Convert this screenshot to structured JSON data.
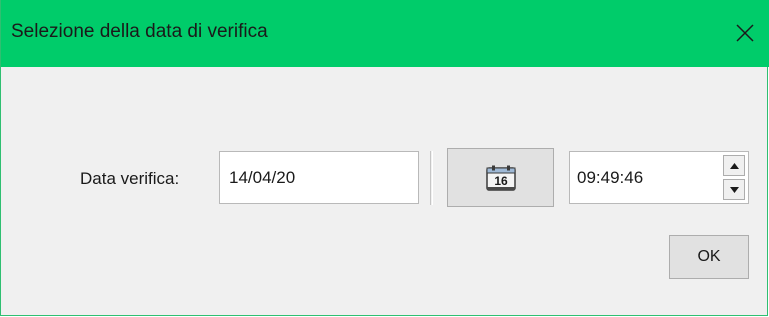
{
  "window": {
    "title": "Selezione della data di verifica",
    "accent_color": "#00cc6a"
  },
  "form": {
    "date_label": "Data verifica:",
    "date_value": "14/04/20",
    "calendar_icon_text": "16",
    "calendar_icon": "calendar-icon",
    "time_value": "09:49:46",
    "spin_up_icon": "arrow-up-icon",
    "spin_down_icon": "arrow-down-icon"
  },
  "buttons": {
    "ok_label": "OK"
  }
}
